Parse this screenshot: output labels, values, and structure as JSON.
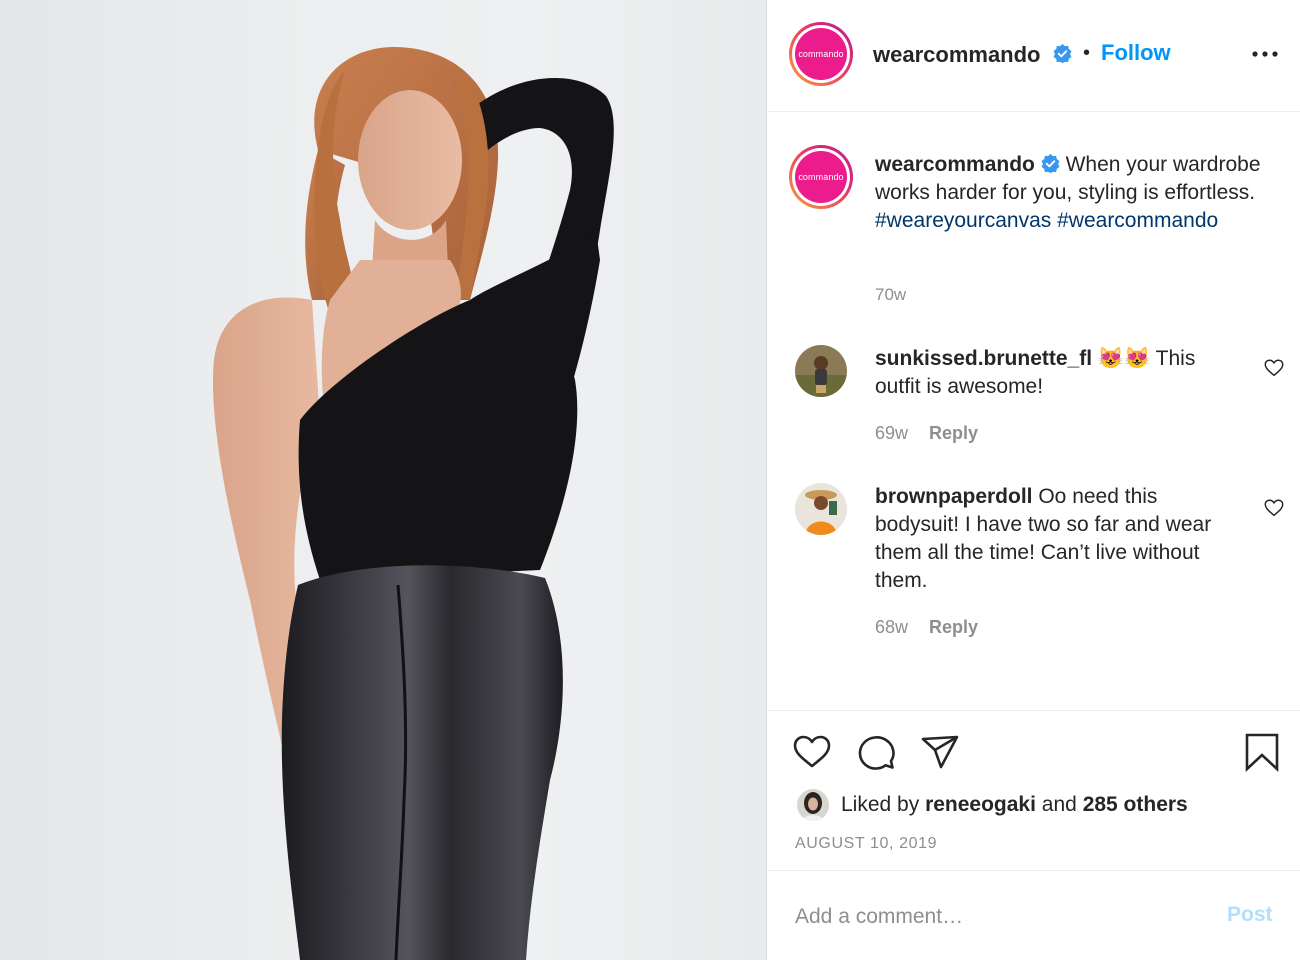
{
  "post": {
    "image_alt": "Model in black one-shoulder bodysuit and faux leather leggings"
  },
  "header": {
    "avatar_logo_text": "commando",
    "username": "wearcommando",
    "separator": "•",
    "follow_label": "Follow",
    "more_icon": "more-horizontal-icon"
  },
  "caption": {
    "avatar_logo_text": "commando",
    "username": "wearcommando",
    "text": "When your wardrobe works harder for you, styling is effortless.",
    "hashtag_1": "#weareyourcanvas",
    "hashtag_2": "#wearcommando",
    "time": "70w"
  },
  "comments": [
    {
      "username": "sunkissed.brunette_fl",
      "emoji": "😻😻",
      "text": "This outfit is awesome!",
      "time": "69w",
      "reply_label": "Reply"
    },
    {
      "username": "brownpaperdoll",
      "text": "Oo need this bodysuit! I have two so far and wear them all the time! Can’t live without them.",
      "time": "68w",
      "reply_label": "Reply"
    }
  ],
  "actions": {
    "liked_by_prefix": "Liked by",
    "liked_by_user": "reneeogaki",
    "liked_by_and": "and",
    "others": "285 others",
    "date": "AUGUST 10, 2019"
  },
  "add_comment": {
    "placeholder": "Add a comment…",
    "post_label": "Post"
  },
  "colors": {
    "brand_link": "#0095f6",
    "hashtag": "#00376b",
    "muted": "#8e8e8e",
    "logo_pink": "#ed1c8d"
  }
}
